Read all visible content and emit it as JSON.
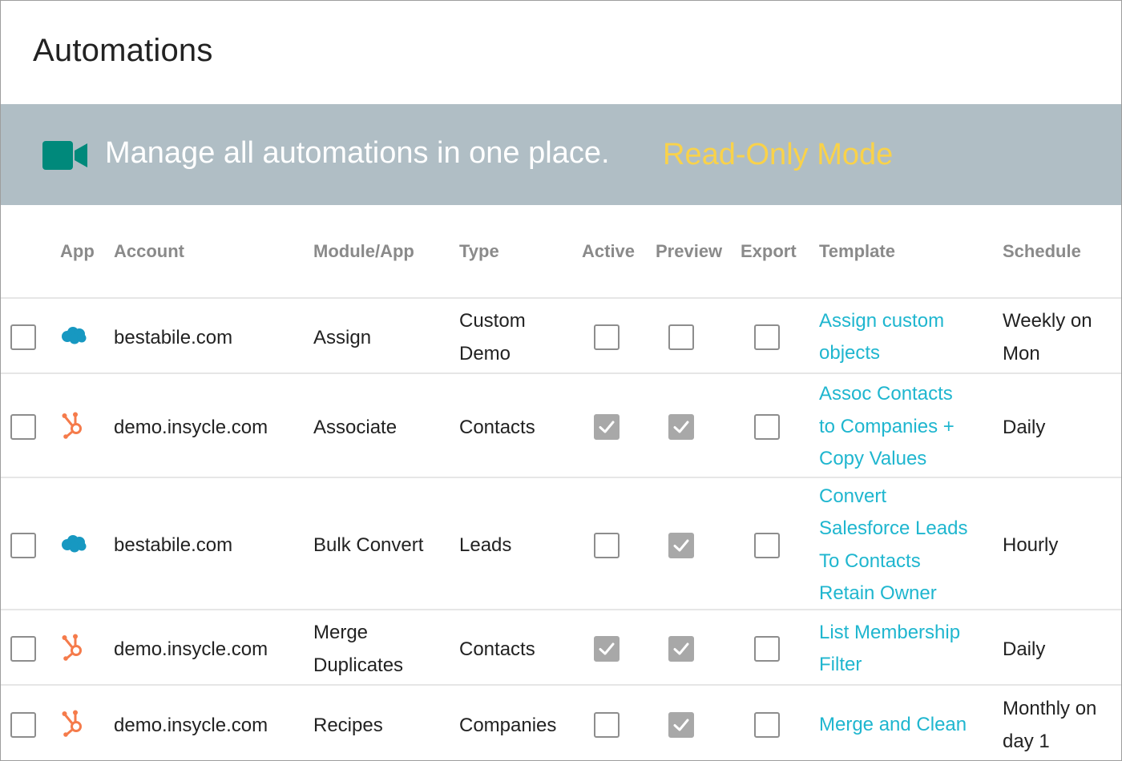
{
  "page": {
    "title": "Automations"
  },
  "banner": {
    "icon": "video-camera-icon",
    "text": "Manage all automations in one place.",
    "mode": "Read-Only Mode",
    "colors": {
      "background": "#b0bec5",
      "icon": "#00897b",
      "mode": "#f9d24a"
    }
  },
  "table": {
    "headers": {
      "app": "App",
      "account": "Account",
      "module": "Module/App",
      "type": "Type",
      "active": "Active",
      "preview": "Preview",
      "export": "Export",
      "template": "Template",
      "schedule": "Schedule"
    },
    "rows": [
      {
        "app": "salesforce-icon",
        "account": "bestabile.com",
        "module": "Assign",
        "type": "Custom\nDemo",
        "active": false,
        "preview": false,
        "export": false,
        "template": "Assign custom\nobjects",
        "schedule": "Weekly on\nMon"
      },
      {
        "app": "hubspot-icon",
        "account": "demo.insycle.com",
        "module": "Associate",
        "type": "Contacts",
        "active": true,
        "preview": true,
        "export": false,
        "template": "Assoc Contacts\nto Companies +\nCopy Values",
        "schedule": "Daily"
      },
      {
        "app": "salesforce-icon",
        "account": "bestabile.com",
        "module": "Bulk Convert",
        "type": "Leads",
        "active": false,
        "preview": true,
        "export": false,
        "template": "Convert\nSalesforce Leads\nTo Contacts\nRetain Owner",
        "schedule": "Hourly"
      },
      {
        "app": "hubspot-icon",
        "account": "demo.insycle.com",
        "module": "Merge\nDuplicates",
        "type": "Contacts",
        "active": true,
        "preview": true,
        "export": false,
        "template": "List Membership\nFilter",
        "schedule": "Daily"
      },
      {
        "app": "hubspot-icon",
        "account": "demo.insycle.com",
        "module": "Recipes",
        "type": "Companies",
        "active": false,
        "preview": true,
        "export": false,
        "template": "Merge and Clean",
        "schedule": "Monthly on\nday 1"
      }
    ]
  }
}
